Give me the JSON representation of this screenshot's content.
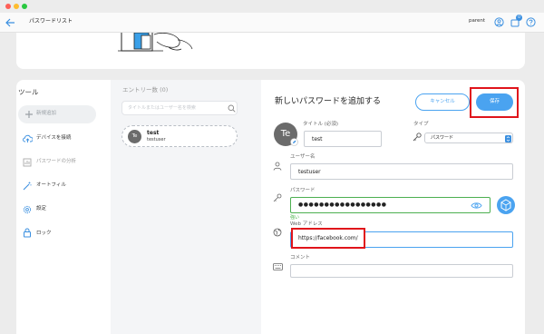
{
  "app": {
    "title": "パスワードリスト",
    "user": "parent",
    "badge_count": "0"
  },
  "sidebar": {
    "title": "ツール",
    "items": [
      {
        "label": "新規追加"
      },
      {
        "label": "デバイスを接続"
      },
      {
        "label": "パスワードの分析"
      },
      {
        "label": "オートフィル"
      },
      {
        "label": "設定"
      },
      {
        "label": "ロック"
      }
    ]
  },
  "list": {
    "header": "エントリー数 (0)",
    "search_placeholder": "タイトルまたはユーザー名を検索",
    "entries": [
      {
        "avatar": "Te",
        "title": "test",
        "user": "testuser"
      }
    ]
  },
  "form": {
    "heading": "新しいパスワードを追加する",
    "cancel_label": "キャンセル",
    "save_label": "保存",
    "avatar": "Te",
    "title_label": "タイトル (必須)",
    "title_value": "test",
    "type_label": "タイプ",
    "type_value": "パスワード",
    "username_label": "ユーザー名",
    "username_value": "testuser",
    "password_label": "パスワード",
    "password_value": "●●●●●●●●●●●●●●●●●",
    "strength": "強い",
    "url_label": "Web アドレス",
    "url_value": "https://facebook.com/",
    "comment_label": "コメント",
    "comment_value": ""
  },
  "colors": {
    "accent": "#4aa3f0",
    "strength": "#3fae3f",
    "highlight": "#e0141b"
  }
}
